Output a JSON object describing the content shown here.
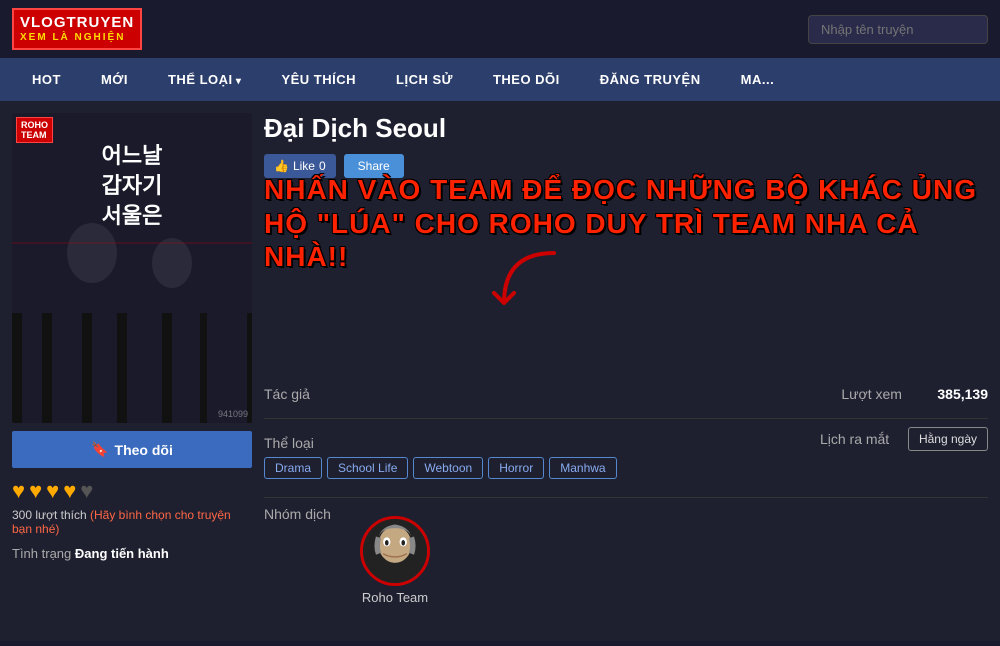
{
  "header": {
    "logo_main": "VLOGTRUYEN",
    "logo_sub": "XEM LÀ NGHIỆN",
    "search_placeholder": "Nhập tên truyện"
  },
  "nav": {
    "items": [
      {
        "label": "HOT",
        "has_arrow": false
      },
      {
        "label": "MỚI",
        "has_arrow": false
      },
      {
        "label": "THỂ LOẠI",
        "has_arrow": true
      },
      {
        "label": "YÊU THÍCH",
        "has_arrow": false
      },
      {
        "label": "LỊCH SỬ",
        "has_arrow": false
      },
      {
        "label": "THEO DÕI",
        "has_arrow": false
      },
      {
        "label": "ĐĂNG TRUYỆN",
        "has_arrow": false
      },
      {
        "label": "MA...",
        "has_arrow": false
      }
    ]
  },
  "manga": {
    "title": "Đại Dịch Seoul",
    "cover_title": "어느날\n갑자기\n서울은",
    "like_label": "Like",
    "like_count": "0",
    "share_label": "Share",
    "follow_label": "Theo dõi",
    "author_label": "Tác giả",
    "author_value": "",
    "genre_label": "Thể loại",
    "genres": [
      "Drama",
      "School Life",
      "Webtoon",
      "Horror",
      "Manhwa"
    ],
    "translator_label": "Nhóm dịch",
    "translator_name": "Roho Team",
    "views_label": "Lượt xem",
    "views_count": "385,139",
    "release_label": "Lịch ra mắt",
    "release_value": "Hằng ngày",
    "status_label": "Tình trạng",
    "status_value": "Đang tiến hành",
    "stars_count": 4,
    "votes_count": "300",
    "votes_label": "lượt thích",
    "vote_prompt": "(Hãy bình chọn cho truyện bạn nhé)",
    "promo_text_line1": "NHẤN VÀO TEAM ĐỂ ĐỌC NHỮNG BỘ KHÁC ỦNG",
    "promo_text_line2": "HỘ \"LÚA\" CHO ROHO DUY TRÌ TEAM NHA CẢ NHÀ!!",
    "badge_text": "ROHO\nTEAM"
  },
  "colors": {
    "accent_blue": "#2c3e6b",
    "accent_red": "#cc0000",
    "promo_red": "#ff2200",
    "star_gold": "#ffaa00",
    "tag_border": "#5588cc"
  }
}
